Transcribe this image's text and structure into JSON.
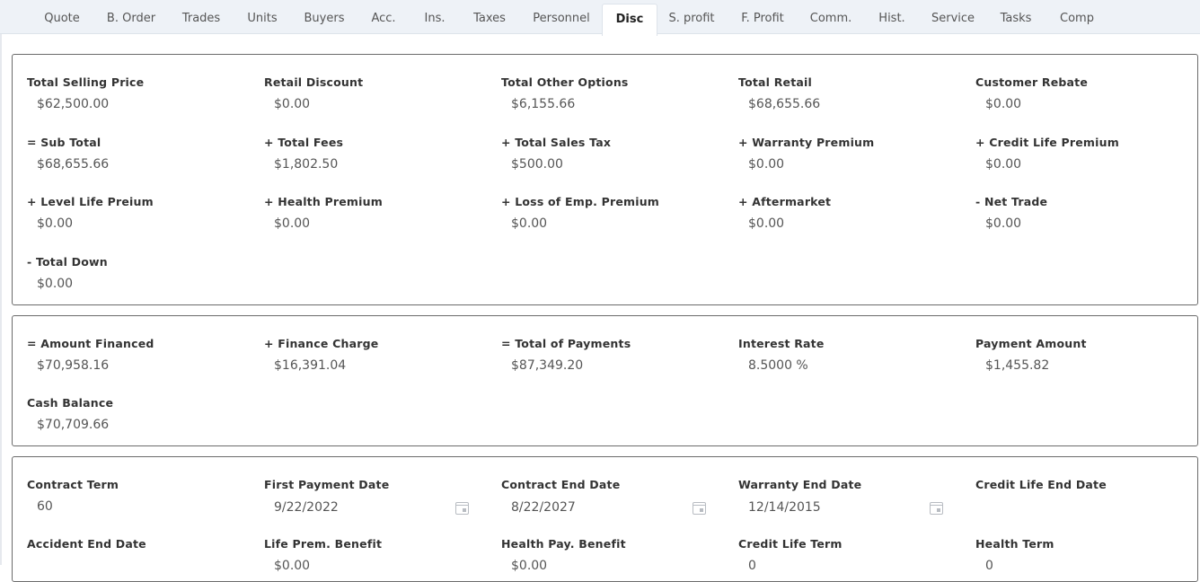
{
  "tabs": [
    {
      "label": "Quote",
      "active": false
    },
    {
      "label": "B. Order",
      "active": false
    },
    {
      "label": "Trades",
      "active": false
    },
    {
      "label": "Units",
      "active": false
    },
    {
      "label": "Buyers",
      "active": false
    },
    {
      "label": "Acc.",
      "active": false
    },
    {
      "label": "Ins.",
      "active": false
    },
    {
      "label": "Taxes",
      "active": false
    },
    {
      "label": "Personnel",
      "active": false
    },
    {
      "label": "Disc",
      "active": true
    },
    {
      "label": "S. profit",
      "active": false
    },
    {
      "label": "F. Profit",
      "active": false
    },
    {
      "label": "Comm.",
      "active": false
    },
    {
      "label": "Hist.",
      "active": false
    },
    {
      "label": "Service",
      "active": false
    },
    {
      "label": "Tasks",
      "active": false
    },
    {
      "label": "Comp",
      "active": false
    }
  ],
  "pricing": {
    "total_selling_price": {
      "label": "Total Selling Price",
      "value": "$62,500.00"
    },
    "retail_discount": {
      "label": "Retail Discount",
      "value": "$0.00"
    },
    "total_other_options": {
      "label": "Total Other Options",
      "value": "$6,155.66"
    },
    "total_retail": {
      "label": "Total Retail",
      "value": "$68,655.66"
    },
    "customer_rebate": {
      "label": "Customer Rebate",
      "value": "$0.00"
    },
    "sub_total": {
      "label": "= Sub Total",
      "value": "$68,655.66"
    },
    "total_fees": {
      "label": "+ Total Fees",
      "value": "$1,802.50"
    },
    "total_sales_tax": {
      "label": "+ Total Sales Tax",
      "value": "$500.00"
    },
    "warranty_premium": {
      "label": "+ Warranty Premium",
      "value": "$0.00"
    },
    "credit_life_premium": {
      "label": "+ Credit Life Premium",
      "value": "$0.00"
    },
    "level_life_premium": {
      "label": "+ Level Life Preium",
      "value": "$0.00"
    },
    "health_premium": {
      "label": "+ Health Premium",
      "value": "$0.00"
    },
    "loss_of_emp_premium": {
      "label": "+ Loss of Emp. Premium",
      "value": "$0.00"
    },
    "aftermarket": {
      "label": "+ Aftermarket",
      "value": "$0.00"
    },
    "net_trade": {
      "label": "- Net Trade",
      "value": "$0.00"
    },
    "total_down": {
      "label": "- Total Down",
      "value": "$0.00"
    }
  },
  "financing": {
    "amount_financed": {
      "label": "= Amount Financed",
      "value": "$70,958.16"
    },
    "finance_charge": {
      "label": "+ Finance Charge",
      "value": "$16,391.04"
    },
    "total_of_payments": {
      "label": "= Total of Payments",
      "value": "$87,349.20"
    },
    "interest_rate": {
      "label": "Interest Rate",
      "value": "8.5000 %"
    },
    "payment_amount": {
      "label": "Payment Amount",
      "value": "$1,455.82"
    },
    "cash_balance": {
      "label": "Cash Balance",
      "value": "$70,709.66"
    }
  },
  "terms": {
    "contract_term": {
      "label": "Contract Term",
      "value": "60"
    },
    "first_payment_date": {
      "label": "First Payment Date",
      "value": "9/22/2022"
    },
    "contract_end_date": {
      "label": "Contract End Date",
      "value": "8/22/2027"
    },
    "warranty_end_date": {
      "label": "Warranty End Date",
      "value": "12/14/2015"
    },
    "credit_life_end_date": {
      "label": "Credit Life End Date",
      "value": ""
    },
    "accident_end_date": {
      "label": "Accident End Date",
      "value": ""
    },
    "life_prem_benefit": {
      "label": "Life Prem. Benefit",
      "value": "$0.00"
    },
    "health_pay_benefit": {
      "label": "Health Pay. Benefit",
      "value": "$0.00"
    },
    "credit_life_term": {
      "label": "Credit Life Term",
      "value": "0"
    },
    "health_term": {
      "label": "Health Term",
      "value": "0"
    }
  },
  "icons": {
    "date_picker": "calendar-icon"
  }
}
